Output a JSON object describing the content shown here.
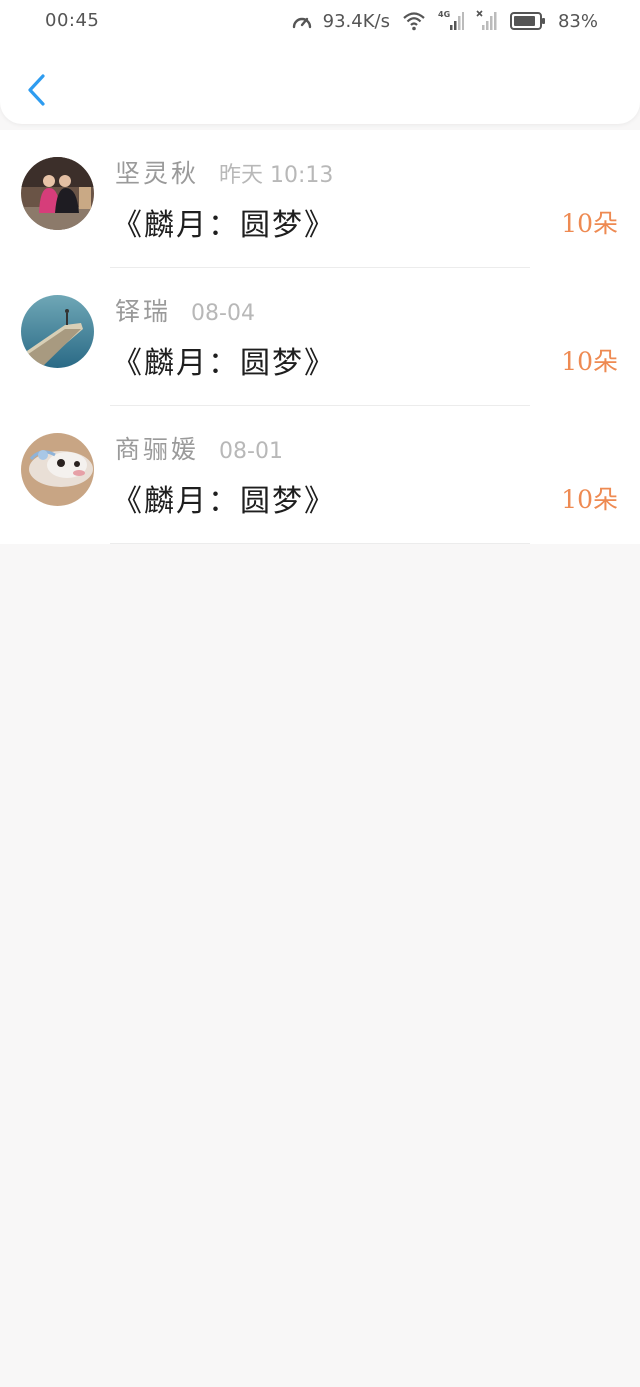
{
  "status_bar": {
    "time": "00:45",
    "speed": "93.4K/s",
    "network": "4G",
    "battery": "83%",
    "icons": [
      "speedometer-icon",
      "wifi-icon",
      "signal-4g-icon",
      "signal-x-icon",
      "battery-icon"
    ]
  },
  "header": {
    "back_icon": "chevron-left-icon",
    "accent_color": "#2e9cf0"
  },
  "gifts": [
    {
      "name": "坚灵秋",
      "time": "昨天  10:13",
      "title": "《麟月：圆梦》",
      "count": "10朵"
    },
    {
      "name": "铎瑞",
      "time": "08-04",
      "title": "《麟月：圆梦》",
      "count": "10朵"
    },
    {
      "name": "商骊媛",
      "time": "08-01",
      "title": "《麟月：圆梦》",
      "count": "10朵"
    }
  ],
  "colors": {
    "count_color": "#ee8a52",
    "name_color": "#9a9a9a",
    "background": "#f8f7f7"
  }
}
